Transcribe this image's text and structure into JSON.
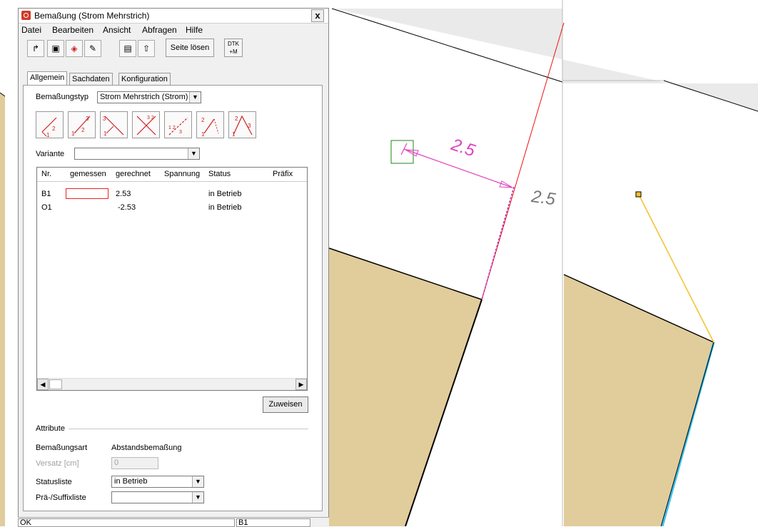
{
  "dialog": {
    "title": "Bemaßung (Strom Mehrstrich)",
    "close_label": "x",
    "menu": [
      "Datei",
      "Bearbeiten",
      "Ansicht",
      "Abfragen",
      "Hilfe"
    ],
    "toolbar_icons": [
      "pin-icon",
      "cube-icon",
      "paint-bucket-icon",
      "draw-icon",
      "print-icon",
      "export-icon"
    ],
    "seite_loesen_label": "Seite lösen",
    "dtk_label": "DTK\n+M",
    "tabs": [
      "Allgemein",
      "Sachdaten",
      "Konfiguration"
    ],
    "bemassungstyp_label": "Bemaßungstyp",
    "bemassungstyp_value": "Strom Mehrstrich (Strom)",
    "variante_label": "Variante",
    "variante_value": "",
    "measurement_buttons": [
      "dimension-corner-icon",
      "dimension-diagonal-icon",
      "dimension-cross-icon",
      "dimension-double-cross-icon",
      "dimension-chain-icon",
      "dimension-angle-icon",
      "dimension-triangle-icon"
    ],
    "list": {
      "columns": [
        "Nr.",
        "gemessen",
        "gerechnet",
        "Spannung",
        "Status",
        "Präfix"
      ],
      "rows": [
        {
          "nr": "B1",
          "gemessen": "",
          "gerechnet": "2.53",
          "spannung": "",
          "status": "in Betrieb",
          "praefix": ""
        },
        {
          "nr": "O1",
          "gemessen": "",
          "gerechnet": "-2.53",
          "spannung": "",
          "status": "in Betrieb",
          "praefix": ""
        }
      ]
    },
    "zuweisen_label": "Zuweisen",
    "attribute_label": "Attribute",
    "bemassungsart_label": "Bemaßungsart",
    "bemassungsart_value": "Abstandsbemaßung",
    "versatz_label": "Versatz [cm]",
    "versatz_value": "0",
    "statusliste_label": "Statusliste",
    "statusliste_value": "in Betrieb",
    "suffixliste_label": "Prä-/Suffixliste",
    "suffixliste_value": ""
  },
  "statusbar": {
    "left": "OK",
    "right": "B1"
  },
  "map": {
    "dimension_text_main": "2.5",
    "dimension_text_secondary": "2.5",
    "colors": {
      "parcel_fill": "#e1cc9b",
      "road_fill": "#ffffff",
      "grey_fill": "#eaeaea",
      "dimension_magenta": "#e040c0",
      "line_red": "#e11",
      "line_yellow": "#f3c12b",
      "line_cyan": "#3cc0e8",
      "marker_green": "#1a8a1a"
    }
  }
}
